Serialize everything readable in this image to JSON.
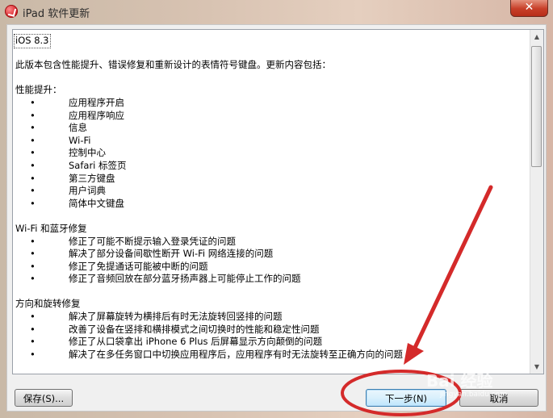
{
  "window": {
    "title": "iPad 软件更新",
    "close_label": "✕"
  },
  "notes": {
    "version": "iOS 8.3",
    "intro": "此版本包含性能提升、错误修复和重新设计的表情符号键盘。更新内容包括：",
    "bullet": "•",
    "sections": [
      {
        "heading": "性能提升：",
        "items": [
          "应用程序开启",
          "应用程序响应",
          "信息",
          "Wi-Fi",
          "控制中心",
          "Safari 标签页",
          "第三方键盘",
          "用户词典",
          "简体中文键盘"
        ]
      },
      {
        "heading": "Wi-Fi 和蓝牙修复",
        "items": [
          "修正了可能不断提示输入登录凭证的问题",
          "解决了部分设备间歇性断开 Wi-Fi 网络连接的问题",
          "修正了免提通话可能被中断的问题",
          "修正了音频回放在部分蓝牙扬声器上可能停止工作的问题"
        ]
      },
      {
        "heading": "方向和旋转修复",
        "items": [
          "解决了屏幕旋转为横排后有时无法旋转回竖排的问题",
          "改善了设备在竖排和横排模式之间切换时的性能和稳定性问题",
          "修正了从口袋拿出 iPhone 6 Plus 后屏幕显示方向颠倒的问题",
          "解决了在多任务窗口中切换应用程序后，应用程序有时无法旋转至正确方向的问题"
        ]
      }
    ]
  },
  "buttons": {
    "save": "保存(S)...",
    "next": "下一步(N)",
    "cancel": "取消"
  },
  "watermark": {
    "text": "Bai 经验",
    "sub": "jingyan.baidu.com"
  },
  "icons": {
    "app": "itunes-icon",
    "scroll_up": "▲",
    "scroll_down": "▼"
  },
  "colors": {
    "annotation": "#d42a2a",
    "title_bar": "#d7c2b1"
  }
}
